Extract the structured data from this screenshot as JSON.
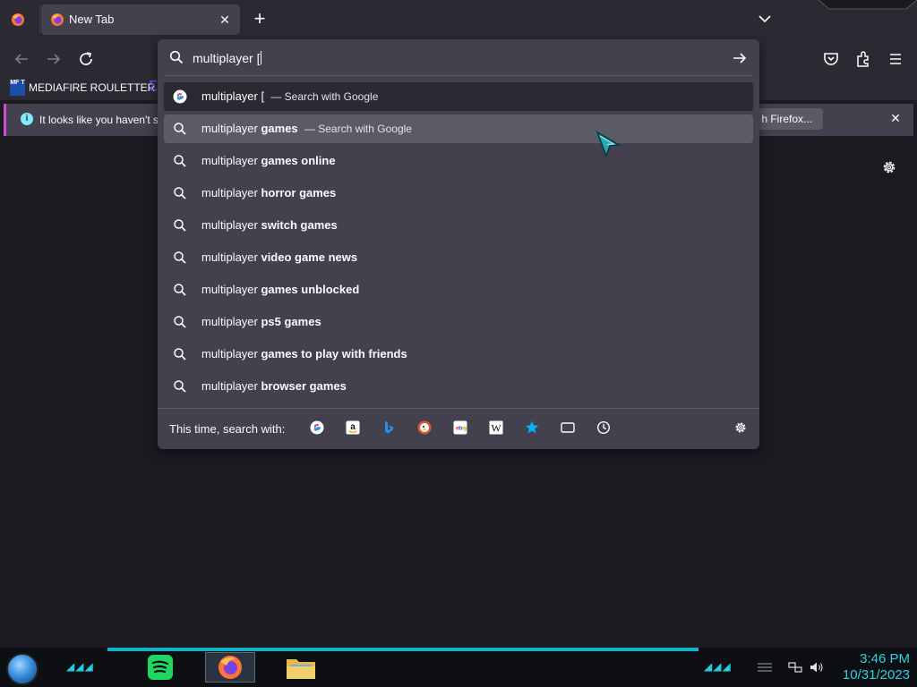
{
  "tabs": [
    {
      "title": "New Tab",
      "close_glyph": "✕"
    }
  ],
  "newtab_glyph": "+",
  "bookmarks": {
    "icon_text": "MF T",
    "items": [
      {
        "label": "MEDIAFIRE ROULETTER"
      }
    ]
  },
  "infobar": {
    "message": "It looks like you haven't s",
    "button_label": "h Firefox...",
    "close_glyph": "✕"
  },
  "urlbar": {
    "typed_text": "multiplayer [",
    "heuristic": {
      "text": "multiplayer [",
      "action": "— Search with Google",
      "icon": "google-icon"
    },
    "suggestions": [
      {
        "prefix": "multiplayer ",
        "bold": "games",
        "action": "— Search with Google"
      },
      {
        "prefix": "multiplayer ",
        "bold": "games online",
        "action": ""
      },
      {
        "prefix": "multiplayer ",
        "bold": "horror games",
        "action": ""
      },
      {
        "prefix": "multiplayer ",
        "bold": "switch games",
        "action": ""
      },
      {
        "prefix": "multiplayer ",
        "bold": "video game news",
        "action": ""
      },
      {
        "prefix": "multiplayer ",
        "bold": "games unblocked",
        "action": ""
      },
      {
        "prefix": "multiplayer ",
        "bold": "ps5 games",
        "action": ""
      },
      {
        "prefix": "multiplayer ",
        "bold": "games to play with friends",
        "action": ""
      },
      {
        "prefix": "multiplayer ",
        "bold": "browser games",
        "action": ""
      }
    ],
    "oneoff_label": "This time, search with:",
    "engines": [
      "google-icon",
      "amazon-icon",
      "bing-icon",
      "duckduckgo-icon",
      "ebay-icon",
      "wikipedia-icon",
      "bookmarks-icon",
      "tabs-icon",
      "history-icon"
    ]
  },
  "taskbar": {
    "time": "3:46 PM",
    "date": "10/31/2023"
  },
  "colors": {
    "toolbar": "#2b2a33",
    "popup": "#42414d",
    "page": "#1c1b22",
    "accent": "#80ebff",
    "clock": "#2ad2e0"
  }
}
